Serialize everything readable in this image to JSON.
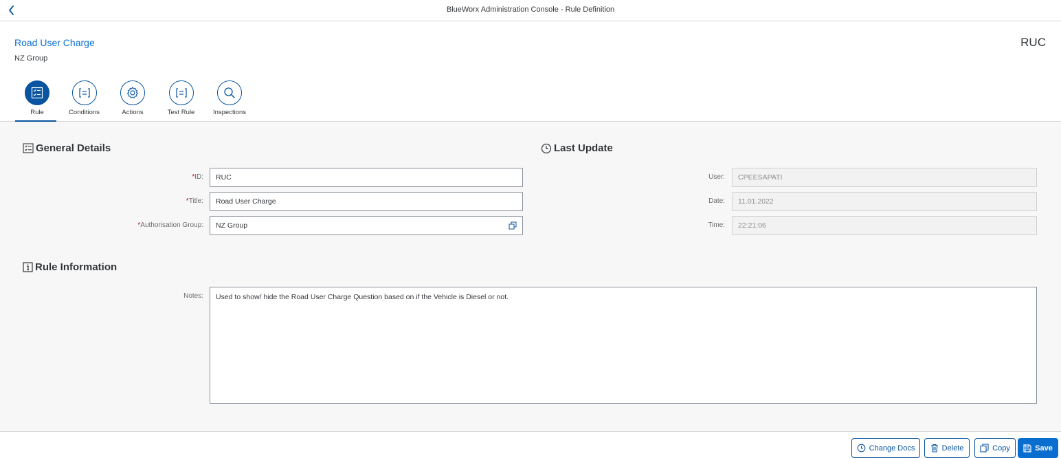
{
  "shell": {
    "title": "BlueWorx Administration Console - Rule Definition"
  },
  "header": {
    "title": "Road User Charge",
    "subtitle": "NZ Group",
    "id_label": "RUC"
  },
  "tabs": [
    {
      "label": "Rule",
      "icon": "checklist-icon",
      "active": true
    },
    {
      "label": "Conditions",
      "icon": "list-icon",
      "active": false
    },
    {
      "label": "Actions",
      "icon": "gear-icon",
      "active": false
    },
    {
      "label": "Test Rule",
      "icon": "list-icon",
      "active": false
    },
    {
      "label": "Inspections",
      "icon": "search-icon",
      "active": false
    }
  ],
  "general": {
    "title": "General Details",
    "required_mark": "*",
    "id_label": "ID:",
    "id_value": "RUC",
    "title_label": "Title:",
    "title_value": "Road User Charge",
    "group_label": "Authorisation Group:",
    "group_value": "NZ Group"
  },
  "last_update": {
    "title": "Last Update",
    "user_label": "User:",
    "user_value": "CPEESAPATI",
    "date_label": "Date:",
    "date_value": "11.01.2022",
    "time_label": "Time:",
    "time_value": "22:21:06"
  },
  "rule_info": {
    "title": "Rule Information",
    "notes_label": "Notes:",
    "notes_value": "Used to show/ hide the Road User Charge Question based on if the Vehicle is Diesel or not."
  },
  "footer": {
    "change_docs": "Change Docs",
    "delete": "Delete",
    "copy": "Copy",
    "save": "Save"
  },
  "colors": {
    "accent": "#0a6ed1",
    "tab_active": "#0854a0",
    "required": "#bb0000"
  }
}
